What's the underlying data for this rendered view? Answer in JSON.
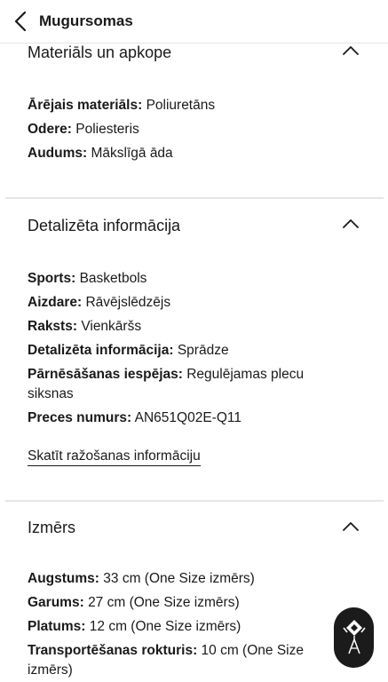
{
  "header": {
    "title": "Mugursomas"
  },
  "sections": [
    {
      "title": "Materiāls un apkope",
      "rows": [
        {
          "label": "Ārējais materiāls:",
          "value": "Poliuretāns"
        },
        {
          "label": "Odere:",
          "value": "Poliesteris"
        },
        {
          "label": "Audums:",
          "value": "Mākslīgā āda"
        }
      ]
    },
    {
      "title": "Detalizēta informācija",
      "rows": [
        {
          "label": "Sports:",
          "value": "Basketbols"
        },
        {
          "label": "Aizdare:",
          "value": "Rāvējslēdzējs"
        },
        {
          "label": "Raksts:",
          "value": "Vienkāršs"
        },
        {
          "label": "Detalizēta informācija:",
          "value": "Sprādze"
        },
        {
          "label": "Pārnēsāšanas iespējas:",
          "value": "Regulējamas plecu siksnas"
        },
        {
          "label": "Preces numurs:",
          "value": "AN651Q02E-Q11"
        }
      ],
      "link": "Skatīt ražošanas informāciju"
    },
    {
      "title": "Izmērs",
      "rows": [
        {
          "label": "Augstums:",
          "value": "33 cm (One Size izmērs)"
        },
        {
          "label": "Garums:",
          "value": "27 cm (One Size izmērs)"
        },
        {
          "label": "Platums:",
          "value": "12 cm (One Size izmērs)"
        },
        {
          "label": "Transportēšanas rokturis:",
          "value": "10 cm (One Size izmērs)"
        }
      ]
    }
  ],
  "icons": {
    "back": "chevron-left-icon",
    "collapse": "chevron-up-icon",
    "assistant": "assistant-logo-icon"
  }
}
